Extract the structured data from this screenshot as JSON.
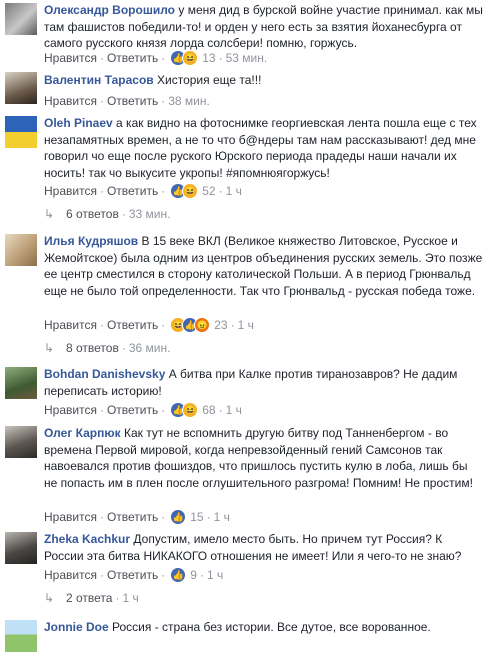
{
  "comments": [
    {
      "author": "Олександр Ворошило",
      "text": "у меня дид в бурской войне участие принимал. как мы там фашистов победили-то! и орден у него есть за взятия йоханесбурга от самого русского князя лорда солсбери! помню, горжусь.",
      "like": "Нравится",
      "reply": "Ответить",
      "count": "13",
      "time": "53 мин."
    },
    {
      "author": "Валентин Тарасов",
      "text": "Хистория еще та!!!",
      "like": "Нравится",
      "reply": "Ответить",
      "time": "38 мин."
    },
    {
      "author": "Oleh Pinaev",
      "text": "а как видно на фотоснимке георгиевская лента пошла еще с тех незапамятных времен, а не то что б@ндеры там нам рассказывают! дед мне говорил чо еще после руского Юрского периода прадеды наши начали их носить! так чо выкусите укропы! #япомнюягоржусь!",
      "like": "Нравится",
      "reply": "Ответить",
      "count": "52",
      "time": "1 ч",
      "replies": "6 ответов",
      "replies_time": "33 мин."
    },
    {
      "author": "Илья Кудряшов",
      "text": "В 15 веке ВКЛ (Великое княжество Литовское, Русское и Жемойтское) была одним из центров объединения русских земель. Это позже ее центр сместился в сторону католической Польши. А в период Грюнвальд еще не было той определенности. Так что Грюнвальд - русская победа тоже.",
      "like": "Нравится",
      "reply": "Ответить",
      "count": "23",
      "time": "1 ч",
      "replies": "8 ответов",
      "replies_time": "36 мин."
    },
    {
      "author": "Bohdan Danishevsky",
      "text": "А битва при Калке против тиранозавров? Не дадим переписать историю!",
      "like": "Нравится",
      "reply": "Ответить",
      "count": "68",
      "time": "1 ч"
    },
    {
      "author": "Олег Карпюк",
      "text": "Как тут не вспомнить другую битву под Танненбергом - во времена Первой мировой, когда непревзойденный гений Самсонов так навоевался против фошиздов, что пришлось пустить кулю в лоба, лишь бы не попасть им в плен после оглушительного разгрома! Помним! Не простим!",
      "like": "Нравится",
      "reply": "Ответить",
      "count": "15",
      "time": "1 ч"
    },
    {
      "author": "Zheka Kachkur",
      "text": "Допустим, имело место быть. Но причем тут Россия? К России эта битва НИКАКОГО отношения не имеет! Или я чего-то не знаю?",
      "like": "Нравится",
      "reply": "Ответить",
      "count": "9",
      "time": "1 ч",
      "replies": "2 ответа",
      "replies_time": "1 ч"
    },
    {
      "author": "Jonnie Doe",
      "text": "Россия - страна без истории. Все дутое, все ворованное."
    }
  ],
  "separator": "·",
  "icons": {
    "like": "thumbs-up",
    "haha": "laughing-face",
    "angry": "angry-face",
    "reply_arrow": "reply-arrow"
  },
  "colors": {
    "author": "#365899",
    "meta": "#90949c",
    "like_blue": "#4267b2",
    "haha_yellow": "#f7b125",
    "angry_orange": "#e9710f"
  }
}
